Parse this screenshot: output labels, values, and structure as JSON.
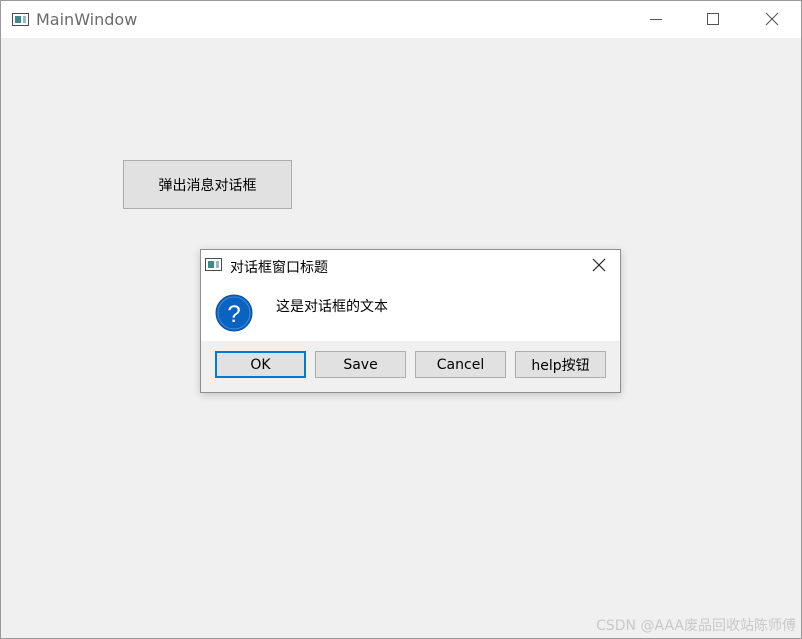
{
  "main_window": {
    "title": "MainWindow",
    "icon": "app-window-icon",
    "controls": [
      "minimize-icon",
      "maximize-icon",
      "close-icon"
    ]
  },
  "trigger_button": {
    "label": "弹出消息对话框"
  },
  "dialog": {
    "title": "对话框窗口标题",
    "icon": "question-icon",
    "text": "这是对话框的文本",
    "buttons": [
      {
        "label": "OK",
        "default": true
      },
      {
        "label": "Save",
        "default": false
      },
      {
        "label": "Cancel",
        "default": false
      },
      {
        "label": "help按钮",
        "default": false
      }
    ]
  },
  "watermark": {
    "text": "CSDN @AAA废品回收站陈师傅"
  },
  "colors": {
    "accent": "#0078d7",
    "question_icon": "#0a63c0",
    "background": "#f0f0f0"
  }
}
